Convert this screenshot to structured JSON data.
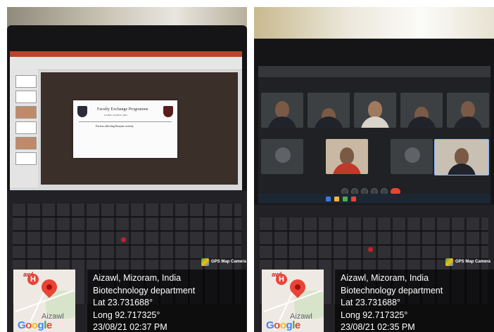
{
  "photos": [
    {
      "gps": {
        "badge": "GPS Map Camera",
        "map_city_label": "awl",
        "map_city": "Aizawl",
        "map_marker_letter": "H",
        "google_logo": "Google",
        "place": "Aizawl, Mizoram, India",
        "department": "Biotechnology department",
        "lat": "Lat 23.731688°",
        "long": "Long 92.717325°",
        "datetime": "23/08/21 02:37 PM"
      },
      "slide": {
        "title": "Faculty Exchange Programme",
        "subtitle": "GCHSC and PUC 2021",
        "topic": "Factors affecting Enzyme activity"
      }
    },
    {
      "gps": {
        "badge": "GPS Map Camera",
        "map_city_label": "awl",
        "map_city": "Aizawl",
        "map_marker_letter": "H",
        "google_logo": "Google",
        "place": "Aizawl, Mizoram, India",
        "department": "Biotechnology department",
        "lat": "Lat 23.731688°",
        "long": "Long 92.717325°",
        "datetime": "23/08/21 02:35 PM"
      }
    }
  ],
  "colors": {
    "map_pin": "#ea4335",
    "overlay": "rgba(0,0,0,0.62)",
    "ppt_accent": "#b7472a",
    "meet_end_call": "#ea4335"
  }
}
